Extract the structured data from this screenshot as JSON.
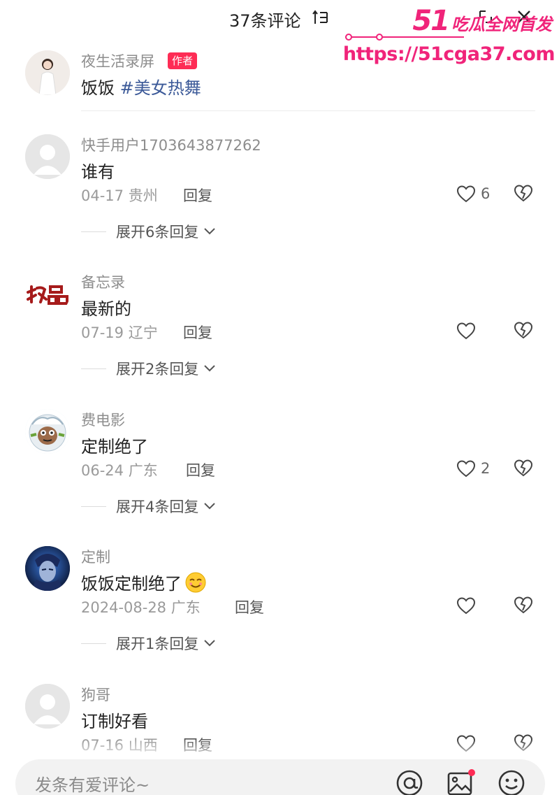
{
  "header": {
    "title": "37条评论"
  },
  "watermark": {
    "brand_number": "51",
    "brand_text": "吃瓜全网首发",
    "url": "https://51cga37.com"
  },
  "post": {
    "username": "夜生活录屏",
    "badge": "作者",
    "text": "饭饭",
    "hashtag": "#美女热舞"
  },
  "comments": [
    {
      "username": "快手用户1703643877262",
      "text": "谁有",
      "meta": "04-17 贵州",
      "reply": "回复",
      "likes": "6",
      "expand": "展开6条回复"
    },
    {
      "username": "备忘录",
      "avatar_text": "极品",
      "text": "最新的",
      "meta": "07-19 辽宁",
      "reply": "回复",
      "likes": "",
      "expand": "展开2条回复"
    },
    {
      "username": "费电影",
      "text": "定制绝了",
      "meta": "06-24 广东",
      "reply": "回复",
      "likes": "2",
      "expand": "展开4条回复"
    },
    {
      "username": "定制",
      "text": "饭饭定制绝了",
      "meta": "2024-08-28 广东",
      "reply": "回复",
      "likes": "",
      "expand": "展开1条回复"
    },
    {
      "username": "狗哥",
      "text": "订制好看",
      "meta": "07-16 山西",
      "reply": "回复",
      "likes": "",
      "expand": ""
    }
  ],
  "input": {
    "placeholder": "发条有爱评论~"
  },
  "colors": {
    "accent": "#fe2c55",
    "hashtag": "#3b5998",
    "watermark": "#f0247a"
  },
  "icons": [
    "sort-icon",
    "expand-icon",
    "close-icon",
    "heart-icon",
    "dislike-heart-icon",
    "chevron-down-icon",
    "at-icon",
    "image-icon",
    "emoji-icon"
  ]
}
